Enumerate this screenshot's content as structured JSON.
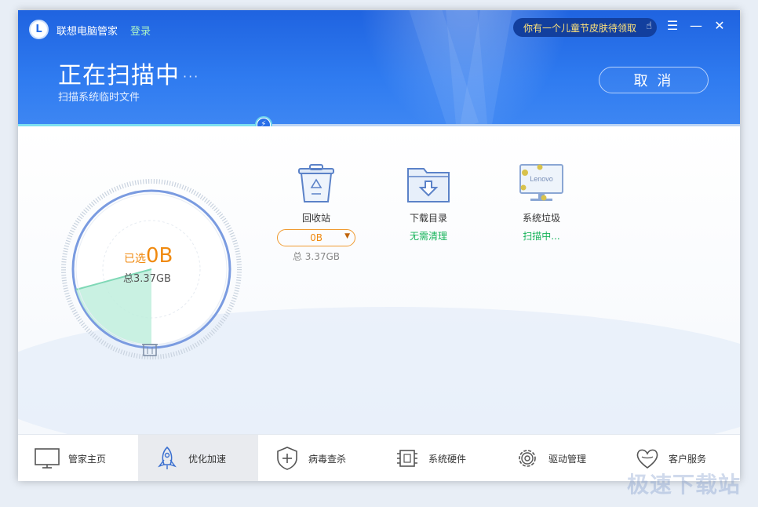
{
  "header": {
    "app_title": "联想电脑管家",
    "login": "登录",
    "promo": "你有一个儿童节皮肤待领取",
    "scan_title": "正在扫描中",
    "scan_dots": "···",
    "scan_subtitle": "扫描系统临时文件",
    "cancel": "取 消",
    "scan_progress": 0.34
  },
  "gauge": {
    "selected_label": "已选",
    "selected_value": "0B",
    "total": "总3.37GB"
  },
  "items": [
    {
      "label": "回收站",
      "size_value": "0B",
      "total": "总 3.37GB"
    },
    {
      "label": "下载目录",
      "status": "无需清理"
    },
    {
      "label": "系统垃圾",
      "status": "扫描中...",
      "monitor_text": "Lenovo"
    }
  ],
  "nav": [
    {
      "label": "管家主页",
      "icon": "monitor-icon"
    },
    {
      "label": "优化加速",
      "icon": "rocket-icon",
      "active": true
    },
    {
      "label": "病毒查杀",
      "icon": "shield-icon"
    },
    {
      "label": "系统硬件",
      "icon": "chip-icon"
    },
    {
      "label": "驱动管理",
      "icon": "gear-icon"
    },
    {
      "label": "客户服务",
      "icon": "heart-icon"
    }
  ],
  "watermark": "极速下载站",
  "colors": {
    "header_blue": "#2a6fe8",
    "accent_orange": "#f08a10",
    "status_green": "#17b35a"
  }
}
